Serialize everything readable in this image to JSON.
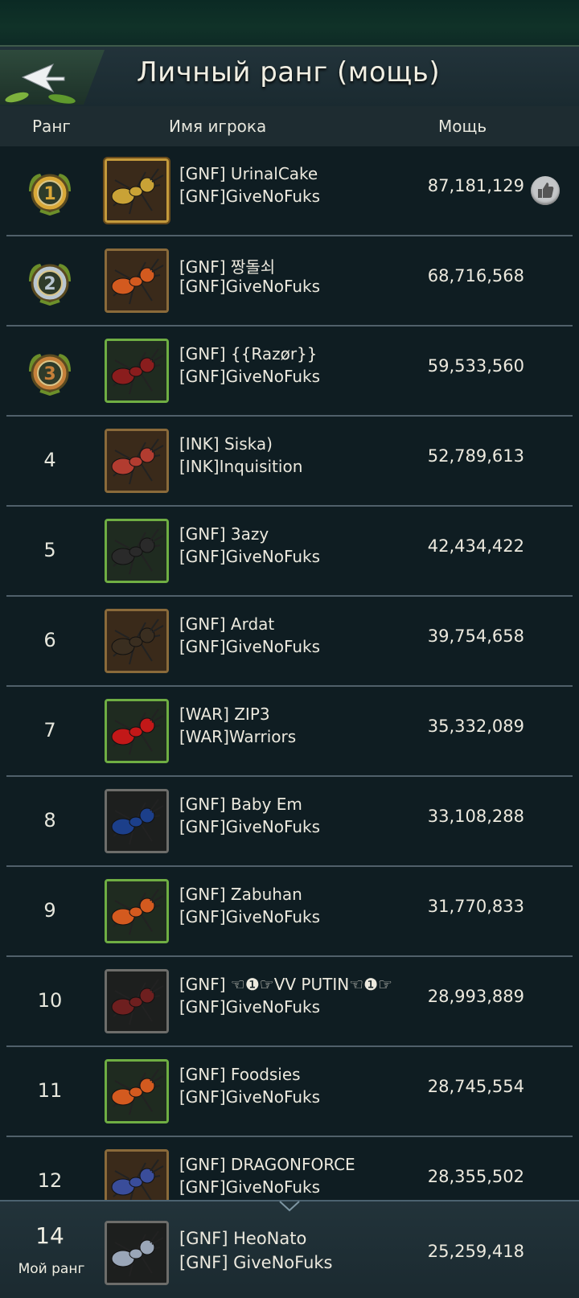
{
  "header": {
    "title": "Личный ранг (мощь)"
  },
  "columns": {
    "rank": "Ранг",
    "player": "Имя игрока",
    "power": "Мощь"
  },
  "rows": [
    {
      "rank": "1",
      "name": "[GNF] UrinalCake",
      "guild": "[GNF]GiveNoFuks",
      "power": "87,181,129",
      "medal": "gold-1",
      "avatar": "gold",
      "ant_color": "#c9a236"
    },
    {
      "rank": "2",
      "name": "[GNF] 짱돌쇠",
      "guild": "[GNF]GiveNoFuks",
      "power": "68,716,568",
      "medal": "silver-2",
      "avatar": "wood",
      "ant_color": "#d35a1f"
    },
    {
      "rank": "3",
      "name": "[GNF] {{Razør}}",
      "guild": "[GNF]GiveNoFuks",
      "power": "59,533,560",
      "medal": "bronze-3",
      "avatar": "green",
      "ant_color": "#8a1d1d"
    },
    {
      "rank": "4",
      "name": "[INK] Siska)",
      "guild": "[INK]Inquisition",
      "power": "52,789,613",
      "medal": "",
      "avatar": "wood",
      "ant_color": "#b23c30"
    },
    {
      "rank": "5",
      "name": "[GNF] 3azy",
      "guild": "[GNF]GiveNoFuks",
      "power": "42,434,422",
      "medal": "",
      "avatar": "green",
      "ant_color": "#2a2a2a"
    },
    {
      "rank": "6",
      "name": "[GNF] Ardat",
      "guild": "[GNF]GiveNoFuks",
      "power": "39,754,658",
      "medal": "",
      "avatar": "wood",
      "ant_color": "#3a2e20"
    },
    {
      "rank": "7",
      "name": "[WAR] ZIP3",
      "guild": "[WAR]Warriors",
      "power": "35,332,089",
      "medal": "",
      "avatar": "green",
      "ant_color": "#c21818"
    },
    {
      "rank": "8",
      "name": "[GNF] Baby Em",
      "guild": "[GNF]GiveNoFuks",
      "power": "33,108,288",
      "medal": "",
      "avatar": "dark",
      "ant_color": "#1c3f8a"
    },
    {
      "rank": "9",
      "name": "[GNF] Zabuhan",
      "guild": "[GNF]GiveNoFuks",
      "power": "31,770,833",
      "medal": "",
      "avatar": "green",
      "ant_color": "#d35a1f"
    },
    {
      "rank": "10",
      "name": "[GNF] ☜❶☞VV PUTIN☜❶☞",
      "guild": "[GNF]GiveNoFuks",
      "power": "28,993,889",
      "medal": "",
      "avatar": "dark",
      "ant_color": "#6e1f1f"
    },
    {
      "rank": "11",
      "name": "[GNF] Foodsies",
      "guild": "[GNF]GiveNoFuks",
      "power": "28,745,554",
      "medal": "",
      "avatar": "green",
      "ant_color": "#d35a1f"
    },
    {
      "rank": "12",
      "name": "[GNF] DRAGONFORCE",
      "guild": "[GNF]GiveNoFuks",
      "power": "28,355,502",
      "medal": "",
      "avatar": "wood",
      "ant_color": "#3a4d9a"
    }
  ],
  "my_rank": {
    "rank": "14",
    "label": "Мой ранг",
    "name": "[GNF] HeoNato",
    "guild": "[GNF] GiveNoFuks",
    "power": "25,259,418",
    "ant_color": "#9aa6b8"
  },
  "colors": {
    "gold": "#d9a838",
    "silver": "#b9c6d0",
    "bronze": "#c5803a"
  }
}
